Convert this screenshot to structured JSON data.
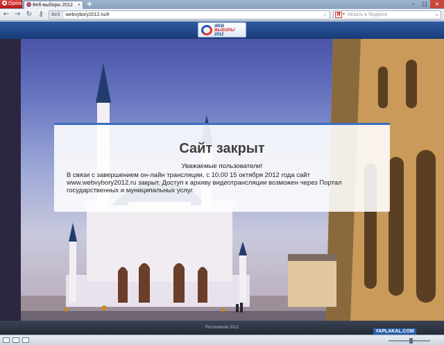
{
  "browser": {
    "menu_label": "Opera",
    "tabs": [
      {
        "label": "Веб-выборы 2012",
        "close": "×"
      }
    ],
    "new_tab": "+",
    "window_controls": {
      "min": "–",
      "max": "□",
      "close": "×"
    },
    "nav": {
      "back": "←",
      "forward": "→",
      "reload": "↻",
      "key": "⚷"
    },
    "address": {
      "badge": "Веб",
      "url": "webvybory2012.ru/#",
      "star": "☆"
    },
    "search": {
      "engine_icon": "Я",
      "placeholder": "Искать в Яндексе",
      "go": "⌕"
    }
  },
  "site": {
    "logo": {
      "line1": "WEB",
      "line2": "ВЫБОРЫ",
      "line3": "2012"
    },
    "notice": {
      "title": "Сайт закрыт",
      "greeting": "Уважаемые пользователи!",
      "message": "В связи с завершением он-лайн трансляции, с 10.00 15 октября 2012 года сайт www.webvybory2012.ru закрыт. Доступ к архиву видеотрансляции возможен через Портал государственных и муниципальных услуг."
    },
    "footer": "Ростелеком 2012"
  },
  "watermark": "YAPLAKAL.COM",
  "colors": {
    "header_blue": "#183b78",
    "notice_accent": "#3a6ec0",
    "opera_red": "#c82424"
  }
}
